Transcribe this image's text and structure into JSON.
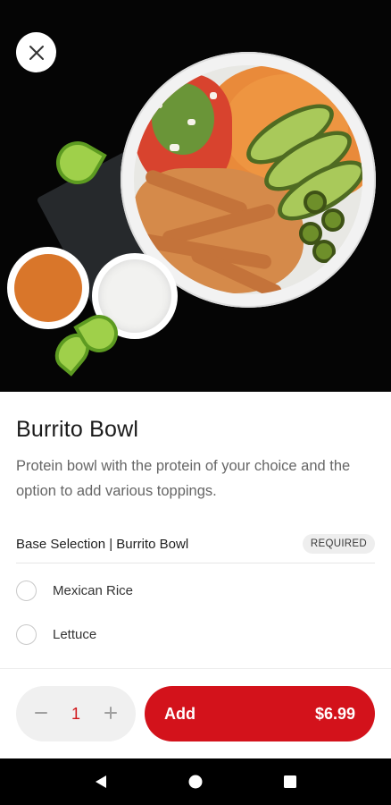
{
  "item": {
    "title": "Burrito Bowl",
    "description": "Protein bowl with the protein of your choice and the option to add various toppings."
  },
  "section": {
    "title": "Base Selection | Burrito Bowl",
    "badge": "REQUIRED",
    "options": [
      {
        "label": "Mexican Rice",
        "selected": false
      },
      {
        "label": "Lettuce",
        "selected": false
      }
    ]
  },
  "order": {
    "quantity": "1",
    "decrement_icon": "minus-icon",
    "increment_icon": "plus-icon",
    "add_label": "Add",
    "price": "$6.99"
  },
  "colors": {
    "accent": "#d3121b",
    "text_primary": "#1a1a1a",
    "text_secondary": "#666666"
  },
  "icons": {
    "close": "close-icon",
    "back": "back-triangle-icon",
    "home": "home-circle-icon",
    "recents": "recents-square-icon"
  }
}
